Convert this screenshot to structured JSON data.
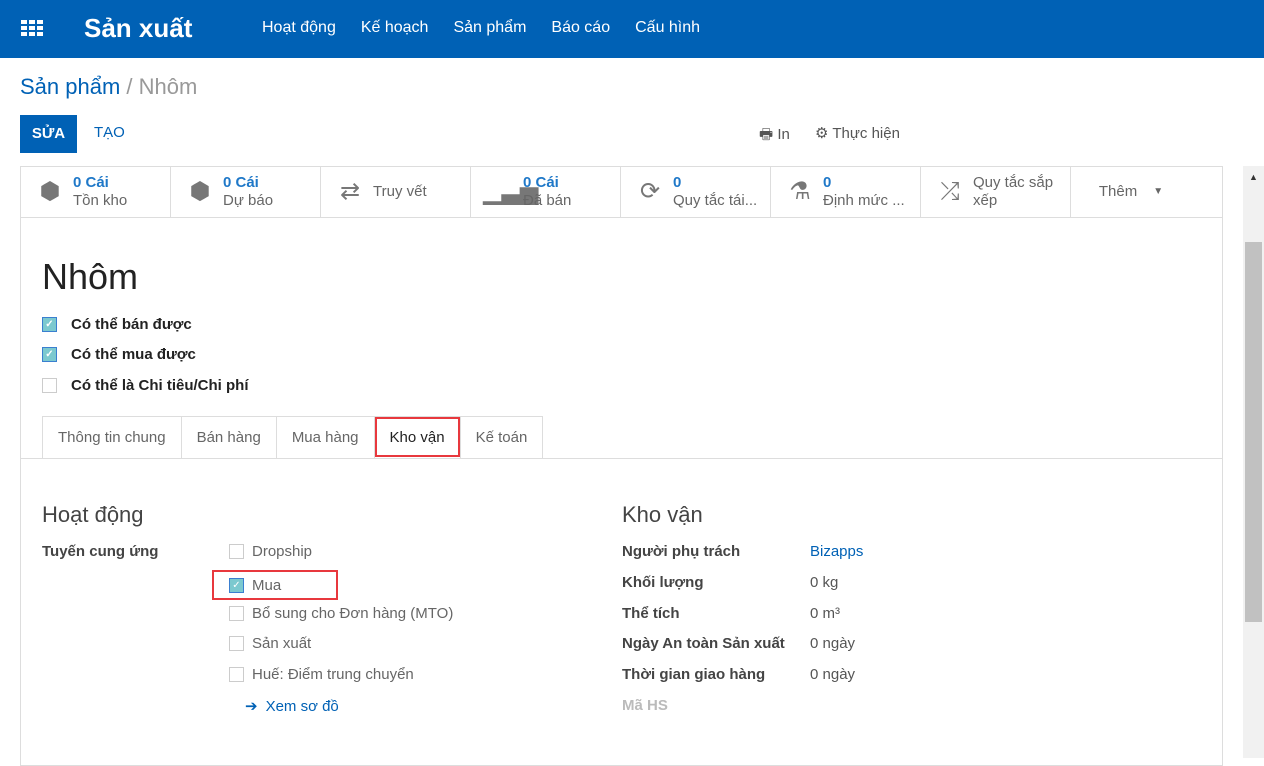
{
  "navbar": {
    "app_name": "Sản xuất",
    "menu": [
      "Hoạt động",
      "Kế hoạch",
      "Sản phẩm",
      "Báo cáo",
      "Cấu hình"
    ],
    "color": "#0061b5"
  },
  "breadcrumb": {
    "parent": "Sản phẩm",
    "separator": "/",
    "current": "Nhôm"
  },
  "toolbar": {
    "edit": "SỬA",
    "create": "TẠO",
    "print": "In",
    "action": "Thực hiện"
  },
  "smart_buttons": [
    {
      "icon": "cubes-icon",
      "value": "0 Cái",
      "label": "Tồn kho"
    },
    {
      "icon": "cubes-icon",
      "value": "0 Cái",
      "label": "Dự báo"
    },
    {
      "icon": "exchange-icon",
      "value": "",
      "label": "Truy vết"
    },
    {
      "icon": "signal-icon",
      "value": "0 Cái",
      "label": "Đã bán"
    },
    {
      "icon": "refresh-icon",
      "value": "0",
      "label": "Quy tắc tái..."
    },
    {
      "icon": "flask-icon",
      "value": "0",
      "label": "Định mức ..."
    },
    {
      "icon": "random-icon",
      "value": "",
      "label": "Quy tắc sắp xếp"
    }
  ],
  "more": "Thêm",
  "product": {
    "name": "Nhôm",
    "options": [
      {
        "label": "Có thể bán được",
        "checked": true
      },
      {
        "label": "Có thể mua được",
        "checked": true
      },
      {
        "label": "Có thể là Chi tiêu/Chi phí",
        "checked": false
      }
    ]
  },
  "tabs": [
    "Thông tin chung",
    "Bán hàng",
    "Mua hàng",
    "Kho vận",
    "Kế toán"
  ],
  "active_tab": "Kho vận",
  "operations": {
    "title": "Hoạt động",
    "routes_label": "Tuyến cung ứng",
    "routes": [
      {
        "label": "Dropship",
        "checked": false
      },
      {
        "label": "Mua",
        "checked": true
      },
      {
        "label": "Bổ sung cho Đơn hàng (MTO)",
        "checked": false
      },
      {
        "label": "Sản xuất",
        "checked": false
      },
      {
        "label": "Huế: Điểm trung chuyển",
        "checked": false
      }
    ],
    "view_diagram": "Xem sơ đồ"
  },
  "logistics": {
    "title": "Kho vận",
    "fields": [
      {
        "label": "Người phụ trách",
        "value": "Bizapps"
      },
      {
        "label": "Khối lượng",
        "value": "0  kg"
      },
      {
        "label": "Thể tích",
        "value": "0  m³"
      },
      {
        "label": "Ngày An toàn Sản xuất",
        "value": "0 ngày"
      },
      {
        "label": "Thời gian giao hàng",
        "value": "0 ngày"
      },
      {
        "label": "Mã HS",
        "value": ""
      }
    ]
  }
}
